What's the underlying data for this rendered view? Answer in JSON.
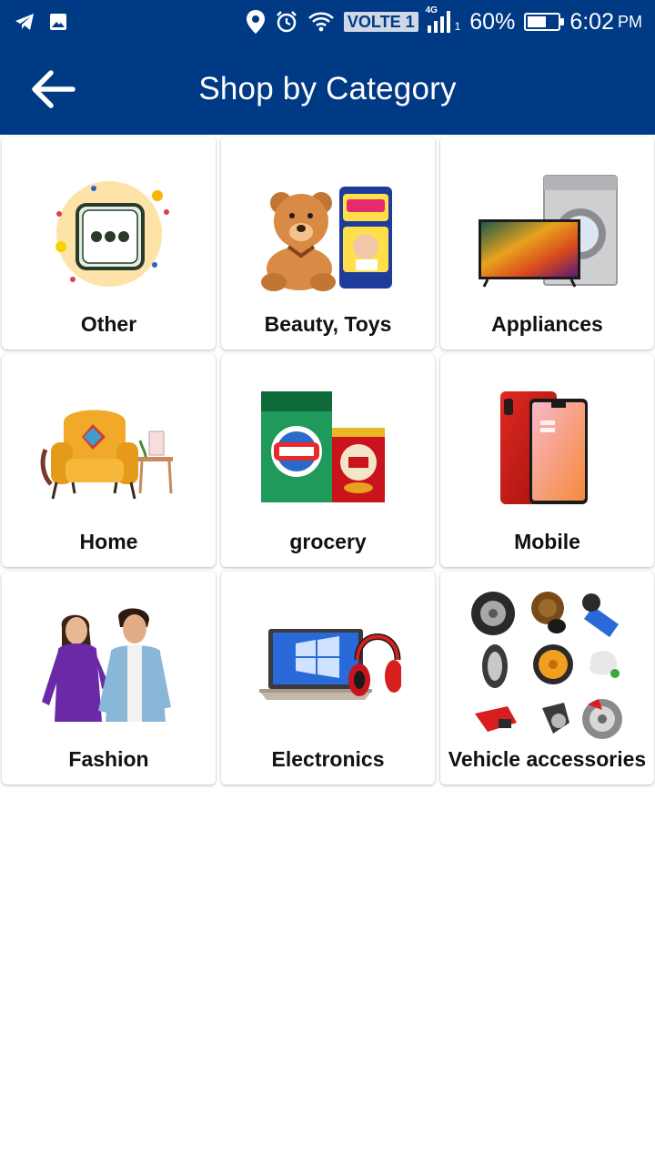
{
  "status_bar": {
    "volte": "VOLTE 1",
    "network": "4G",
    "sim": "1",
    "battery": "60%",
    "battery_level": 0.6,
    "time": "6:02",
    "ampm": "PM"
  },
  "header": {
    "title": "Shop by Category"
  },
  "categories": [
    {
      "label": "Other",
      "icon": "more-dots-icon"
    },
    {
      "label": "Beauty, Toys",
      "icon": "teddy-bear-diapers-image"
    },
    {
      "label": "Appliances",
      "icon": "tv-washing-machine-image"
    },
    {
      "label": "Home",
      "icon": "armchair-image"
    },
    {
      "label": "grocery",
      "icon": "detergent-tea-image"
    },
    {
      "label": "Mobile",
      "icon": "smartphone-image"
    },
    {
      "label": "Fashion",
      "icon": "couple-fashion-image"
    },
    {
      "label": "Electronics",
      "icon": "laptop-headphones-image"
    },
    {
      "label": "Vehicle accessories",
      "icon": "vehicle-parts-image"
    }
  ],
  "colors": {
    "primary": "#003a85",
    "card_bg": "#ffffff",
    "text": "#111111"
  }
}
